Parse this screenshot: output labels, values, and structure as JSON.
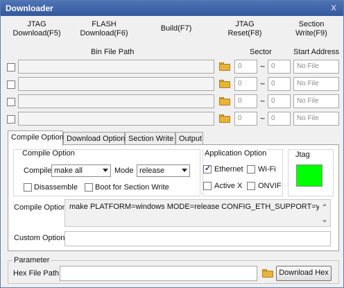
{
  "window": {
    "title": "Downloader",
    "close_label": "X"
  },
  "toolbar": {
    "jtag_download": [
      "JTAG",
      "Download(F5)"
    ],
    "flash_download": [
      "FLASH",
      "Download(F6)"
    ],
    "build": "Build(F7)",
    "jtag_reset": [
      "JTAG",
      "Reset(F8)"
    ],
    "section_write": [
      "Section",
      "Write(F9)"
    ]
  },
  "bin_table": {
    "headers": {
      "bin_path": "Bin File Path",
      "sector": "Sector",
      "start_address": "Start Address"
    },
    "rows": [
      {
        "checked": false,
        "path": "",
        "sector_from": "0",
        "sector_to": "0",
        "start_address": "No File"
      },
      {
        "checked": false,
        "path": "",
        "sector_from": "0",
        "sector_to": "0",
        "start_address": "No File"
      },
      {
        "checked": false,
        "path": "",
        "sector_from": "0",
        "sector_to": "0",
        "start_address": "No File"
      },
      {
        "checked": false,
        "path": "",
        "sector_from": "0",
        "sector_to": "0",
        "start_address": "No File"
      }
    ],
    "range_separator": "~"
  },
  "tabs": [
    "Compile Option",
    "Download Option",
    "Section Write",
    "Output"
  ],
  "active_tab": "Compile Option",
  "compile_option": {
    "group_title": "Compile Option",
    "compile_label": "Compile",
    "compile_value": "make all",
    "mode_label": "Mode",
    "mode_value": "release",
    "disassemble_label": "Disassemble",
    "boot_label": "Boot for Section Write",
    "disassemble_checked": false,
    "boot_checked": false
  },
  "application_option": {
    "group_title": "Application Option",
    "ethernet_label": "Ethernet",
    "ethernet_checked": true,
    "wifi_label": "Wi-Fi",
    "wifi_checked": false,
    "activex_label": "Active X",
    "activex_checked": false,
    "onvif_label": "ONVIF",
    "onvif_checked": false
  },
  "jtag": {
    "label": "Jtag",
    "status_color": "#00ff00"
  },
  "compile_line": {
    "label": "Compile Option",
    "value": "make PLATFORM=windows MODE=release CONFIG_ETH_SUPPORT=y"
  },
  "custom_option": {
    "label": "Custom Option",
    "value": ""
  },
  "parameter": {
    "group_title": "Parameter",
    "hex_label": "Hex File Path",
    "hex_value": "",
    "download_hex_label": "Download Hex"
  },
  "colors": {
    "titlebar": "#3b62a8",
    "jtag_status": "#00ff00",
    "folder": "#e8b33b"
  }
}
